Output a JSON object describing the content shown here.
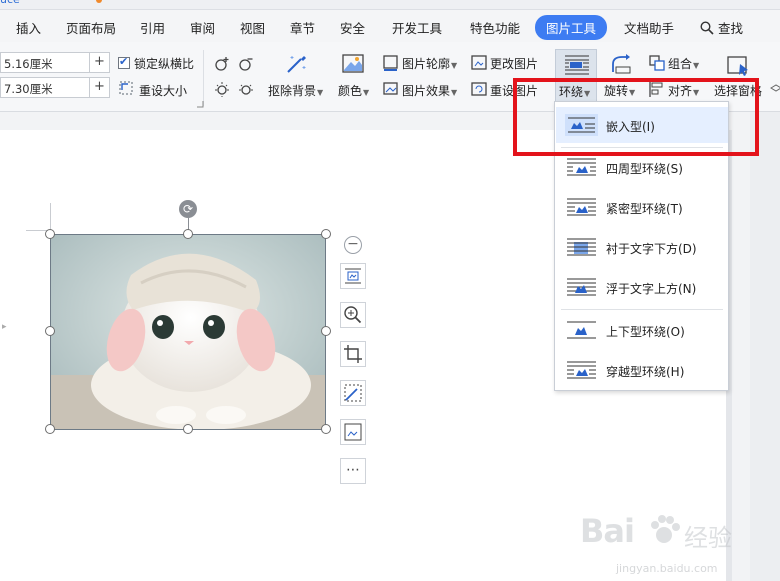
{
  "top_strip": {
    "fragment": "uce",
    "dot_color": "#f08a2c"
  },
  "menu": {
    "tabs": [
      {
        "label": "插入"
      },
      {
        "label": "页面布局"
      },
      {
        "label": "引用"
      },
      {
        "label": "审阅"
      },
      {
        "label": "视图"
      },
      {
        "label": "章节"
      },
      {
        "label": "安全"
      },
      {
        "label": "开发工具"
      },
      {
        "label": "特色功能"
      },
      {
        "label": "图片工具",
        "active": true
      },
      {
        "label": "文档助手"
      }
    ],
    "search_label": "查找"
  },
  "ribbon": {
    "height_value": "5.16厘米",
    "width_value": "7.30厘米",
    "plus_symbol": "+",
    "lock_ratio_label": "锁定纵横比",
    "lock_ratio_checked": true,
    "reset_size_label": "重设大小",
    "remove_bg_label": "抠除背景",
    "color_label": "颜色",
    "outline_label": "图片轮廓",
    "effect_label": "图片效果",
    "change_pic_label": "更改图片",
    "reset_pic_label": "重设图片",
    "wrap_label": "环绕",
    "rotate_label": "旋转",
    "group_label": "组合",
    "align_label": "对齐",
    "select_pane_label": "选择窗格",
    "accent_color": "#3d7cf2"
  },
  "wrap_menu": {
    "items": [
      {
        "label": "嵌入型(I)",
        "highlighted": true
      },
      {
        "label": "四周型环绕(S)"
      },
      {
        "label": "紧密型环绕(T)"
      },
      {
        "label": "衬于文字下方(D)"
      },
      {
        "label": "浮于文字上方(N)"
      },
      {
        "label": "上下型环绕(O)"
      },
      {
        "label": "穿越型环绕(H)"
      }
    ],
    "highlight_color": "#e3131b"
  },
  "float_toolbar": {
    "more_label": "⋯",
    "zoom_out_label": "−",
    "rotate_label": "⟳"
  },
  "watermark": {
    "logo_text": "Bai",
    "logo_sub": "经验",
    "url": "jingyan.baidu.com"
  }
}
